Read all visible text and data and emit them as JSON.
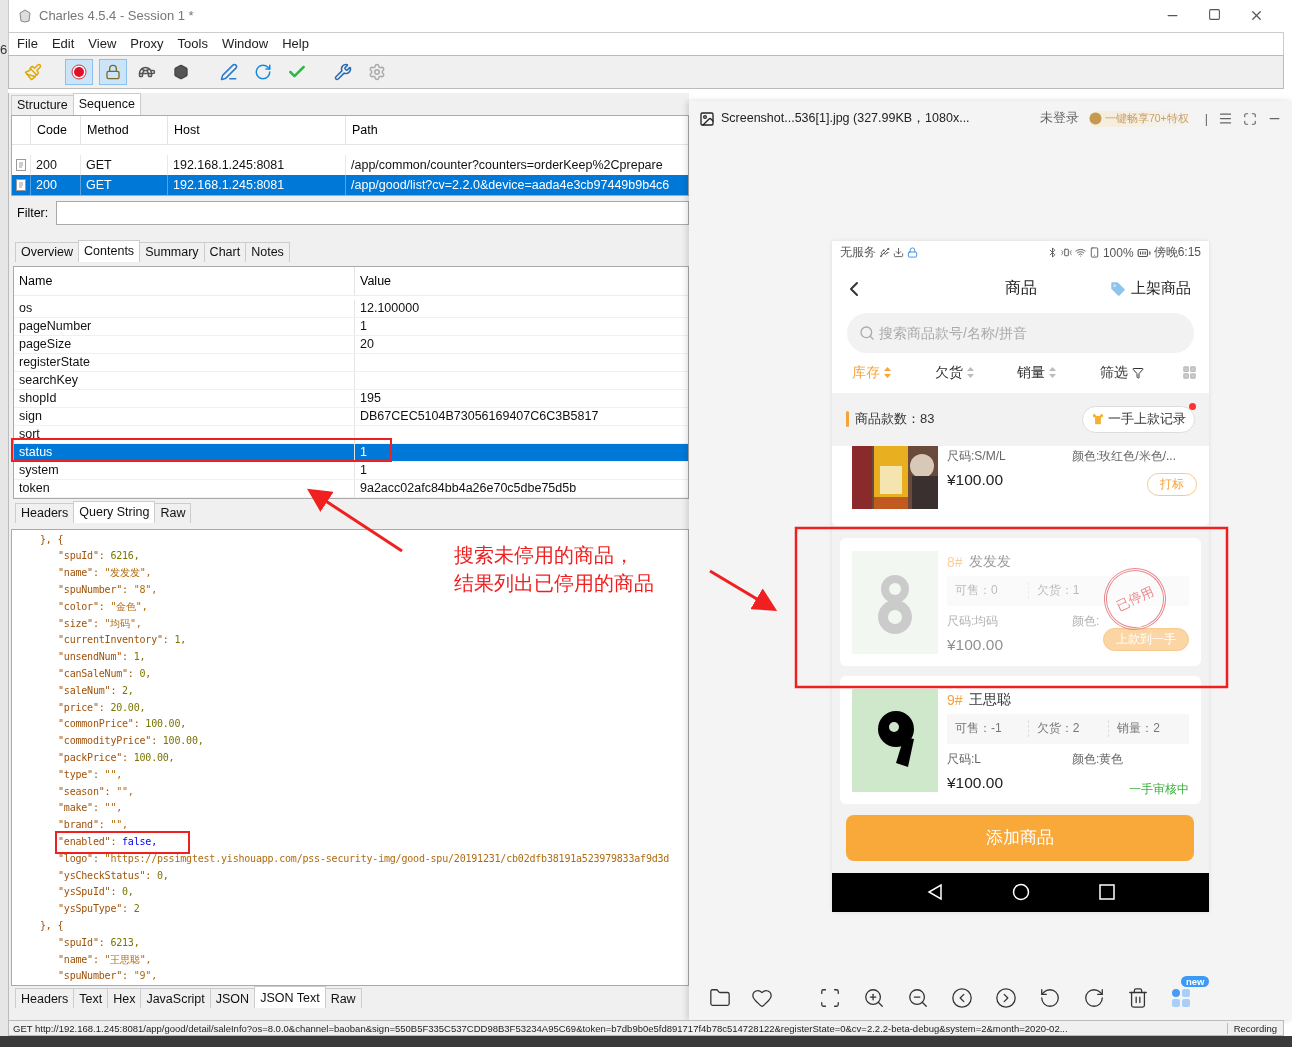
{
  "background_window": {
    "text": "6"
  },
  "window": {
    "title": "Charles 4.5.4 - Session 1 *"
  },
  "menu": [
    "File",
    "Edit",
    "View",
    "Proxy",
    "Tools",
    "Window",
    "Help"
  ],
  "toolbar": [
    {
      "kind": "broom",
      "on": false
    },
    {
      "kind": "record",
      "on": true
    },
    {
      "kind": "throttle",
      "on": true
    },
    {
      "kind": "turtle",
      "on": false
    },
    {
      "kind": "stop",
      "on": false
    },
    {
      "kind": "pen",
      "on": false
    },
    {
      "kind": "refresh",
      "on": false
    },
    {
      "kind": "check",
      "on": false
    },
    {
      "kind": "tools",
      "on": false
    },
    {
      "kind": "gear",
      "on": false
    }
  ],
  "view_tabs": [
    {
      "label": "Structure",
      "selected": false
    },
    {
      "label": "Sequence",
      "selected": true
    }
  ],
  "requests": {
    "columns": [
      "Code",
      "Method",
      "Host",
      "Path"
    ],
    "rows": [
      {
        "code": "200",
        "method": "GET",
        "host": "192.168.1.245:8081",
        "path": "/app/common/counter?counters=orderKeep%2Cprepare",
        "selected": false
      },
      {
        "code": "200",
        "method": "GET",
        "host": "192.168.1.245:8081",
        "path": "/app/good/list?cv=2.2.0&device=aada4e3cb97449b9b4c6",
        "selected": true
      }
    ]
  },
  "filter": {
    "label": "Filter:"
  },
  "detail_tabs": [
    {
      "label": "Overview",
      "selected": false
    },
    {
      "label": "Contents",
      "selected": true
    },
    {
      "label": "Summary",
      "selected": false
    },
    {
      "label": "Chart",
      "selected": false
    },
    {
      "label": "Notes",
      "selected": false
    }
  ],
  "params": {
    "columns": [
      "Name",
      "Value"
    ],
    "rows": [
      {
        "name": "os",
        "value": "12.100000",
        "selected": false
      },
      {
        "name": "pageNumber",
        "value": "1",
        "selected": false
      },
      {
        "name": "pageSize",
        "value": "20",
        "selected": false
      },
      {
        "name": "registerState",
        "selected": false
      },
      {
        "name": "searchKey",
        "selected": false
      },
      {
        "name": "shopId",
        "value": "195",
        "selected": false
      },
      {
        "name": "sign",
        "value": "DB67CEC5104B73056169407C6C3B5817",
        "selected": false
      },
      {
        "name": "sort",
        "selected": false
      },
      {
        "name": "status",
        "value": "1",
        "selected": true
      },
      {
        "name": "system",
        "value": "1",
        "selected": false
      },
      {
        "name": "token",
        "value": "9a2acc02afc84bb4a26e70c5dbe75d5b",
        "selected": false
      }
    ]
  },
  "request_tabs": [
    {
      "label": "Headers",
      "selected": false
    },
    {
      "label": "Query String",
      "selected": true
    },
    {
      "label": "Raw",
      "selected": false
    }
  ],
  "code_lines": [
    {
      "key": "}, {",
      "kind": "brace"
    },
    {
      "key": "\"spuId\":",
      "value": "6216,",
      "kind": "number"
    },
    {
      "key": "\"name\":",
      "value": "\"发发发\",",
      "kind": "string"
    },
    {
      "key": "\"spuNumber\":",
      "value": "\"8\",",
      "kind": "string"
    },
    {
      "key": "\"color\":",
      "value": "\"金色\",",
      "kind": "string"
    },
    {
      "key": "\"size\":",
      "value": "\"均码\",",
      "kind": "string"
    },
    {
      "key": "\"currentInventory\":",
      "value": "1,",
      "kind": "number"
    },
    {
      "key": "\"unsendNum\":",
      "value": "1,",
      "kind": "number"
    },
    {
      "key": "\"canSaleNum\":",
      "value": "0,",
      "kind": "number"
    },
    {
      "key": "\"saleNum\":",
      "value": "2,",
      "kind": "number"
    },
    {
      "key": "\"price\":",
      "value": "20.00,",
      "kind": "number"
    },
    {
      "key": "\"commonPrice\":",
      "value": "100.00,",
      "kind": "number"
    },
    {
      "key": "\"commodityPrice\":",
      "value": "100.00,",
      "kind": "number"
    },
    {
      "key": "\"packPrice\":",
      "value": "100.00,",
      "kind": "number"
    },
    {
      "key": "\"type\":",
      "value": "\"\",",
      "kind": "string"
    },
    {
      "key": "\"season\":",
      "value": "\"\",",
      "kind": "string"
    },
    {
      "key": "\"make\":",
      "value": "\"\",",
      "kind": "string"
    },
    {
      "key": "\"brand\":",
      "value": "\"\",",
      "kind": "string"
    },
    {
      "key": "\"enabled\":",
      "value": "false,",
      "kind": "bool",
      "highlighted": true
    },
    {
      "key": "\"logo\":",
      "value": "\"https://pssimgtest.yishouapp.com/pss-security-img/good-spu/20191231/cb02dfb38191a523979833af9d3d",
      "kind": "string"
    },
    {
      "key": "\"ysCheckStatus\":",
      "value": "0,",
      "kind": "number"
    },
    {
      "key": "\"ysSpuId\":",
      "value": "0,",
      "kind": "number"
    },
    {
      "key": "\"ysSpuType\":",
      "value": "2",
      "kind": "number"
    },
    {
      "key": "}, {",
      "kind": "brace"
    },
    {
      "key": "\"spuId\":",
      "value": "6213,",
      "kind": "number"
    },
    {
      "key": "\"name\":",
      "value": "\"王思聪\",",
      "kind": "string"
    },
    {
      "key": "\"spuNumber\":",
      "value": "\"9\",",
      "kind": "string"
    }
  ],
  "body_tabs": [
    {
      "label": "Headers",
      "selected": false
    },
    {
      "label": "Text",
      "selected": false
    },
    {
      "label": "Hex",
      "selected": false
    },
    {
      "label": "JavaScript",
      "selected": false
    },
    {
      "label": "JSON",
      "selected": false
    },
    {
      "label": "JSON Text",
      "selected": true
    },
    {
      "label": "Raw",
      "selected": false
    }
  ],
  "status_bar": {
    "url": "GET http://192.168.1.245:8081/app/good/detail/saleInfo?os=8.0.0&channel=baoban&sign=550B5F335C537CDD98B3F53234A95C69&token=b7db9b0e5fd891717f4b78c514728122&registerState=0&cv=2.2.2-beta-debug&system=2&month=2020-02...",
    "state": "Recording"
  },
  "annotation": {
    "lines": [
      "搜索未停用的商品，",
      "结果列出已停用的商品"
    ]
  },
  "viewer": {
    "title": "Screenshot...536[1].jpg (327.99KB，1080x...",
    "login": "未登录",
    "promo": "一键畅享70+特权",
    "separator": "|",
    "badge": "new"
  },
  "phone": {
    "carrier": "无服务",
    "battery": "100%",
    "time": "傍晚6:15",
    "title": "商品",
    "action": "上架商品",
    "search_placeholder": "搜索商品款号/名称/拼音",
    "sorts": [
      {
        "label": "库存",
        "selected": true,
        "kind": "sort"
      },
      {
        "label": "欠货",
        "selected": false,
        "kind": "sort"
      },
      {
        "label": "销量",
        "selected": false,
        "kind": "sort"
      },
      {
        "label": "筛选",
        "selected": false,
        "kind": "filter"
      }
    ],
    "count_label": "商品款数：83",
    "record_button": "一手上款记录",
    "products": [
      {
        "kind": "partial",
        "thumb": {
          "kind": "picture"
        },
        "size": "尺码:S/M/L",
        "color_text": "颜色:玫红色/米色/...",
        "price": "¥100.00",
        "disabled": false,
        "action": {
          "kind": "button",
          "label": "打标"
        }
      },
      {
        "kind": "full",
        "thumb": {
          "kind": "picture"
        },
        "code": "8#",
        "name": "发发发",
        "stats": [
          "可售：0",
          "欠货：1"
        ],
        "size": "尺码:均码",
        "color_text": "颜色:",
        "price": "¥100.00",
        "disabled": true,
        "stamp": "已停用",
        "action": {
          "kind": "button",
          "label": "上款到一手"
        }
      },
      {
        "kind": "full",
        "thumb": {
          "kind": "picture"
        },
        "code": "9#",
        "name": "王思聪",
        "stats": [
          "可售：-1",
          "欠货：2",
          "销量：2"
        ],
        "size": "尺码:L",
        "color_text": "颜色:黄色",
        "price": "¥100.00",
        "disabled": false,
        "action": {
          "kind": "status",
          "label": "一手审核中"
        }
      }
    ],
    "add_button": "添加商品"
  }
}
